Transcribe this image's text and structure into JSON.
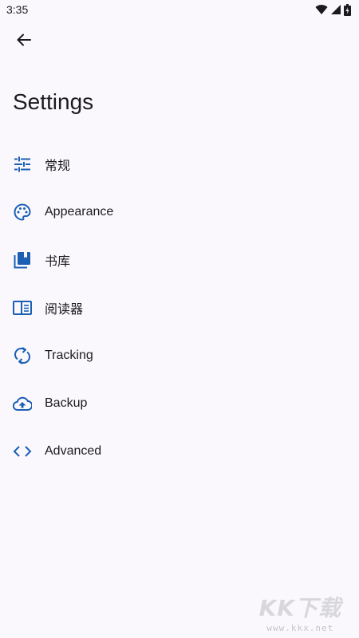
{
  "status_bar": {
    "time": "3:35",
    "icons": [
      "wifi-icon",
      "cellular-icon",
      "battery-icon"
    ]
  },
  "header": {
    "back_icon": "arrow-back-icon",
    "title": "Settings"
  },
  "settings": {
    "items": [
      {
        "label": "常规",
        "icon": "tune-icon"
      },
      {
        "label": "Appearance",
        "icon": "palette-icon"
      },
      {
        "label": "书库",
        "icon": "library-icon"
      },
      {
        "label": "阅读器",
        "icon": "reader-icon"
      },
      {
        "label": "Tracking",
        "icon": "sync-icon"
      },
      {
        "label": "Backup",
        "icon": "cloud-upload-icon"
      },
      {
        "label": "Advanced",
        "icon": "code-icon"
      }
    ]
  },
  "watermark": {
    "logo": "KK下载",
    "url": "www.kkx.net"
  },
  "colors": {
    "background": "#fbf8fd",
    "accent": "#1a5fb4",
    "text": "#1b1b1f"
  }
}
